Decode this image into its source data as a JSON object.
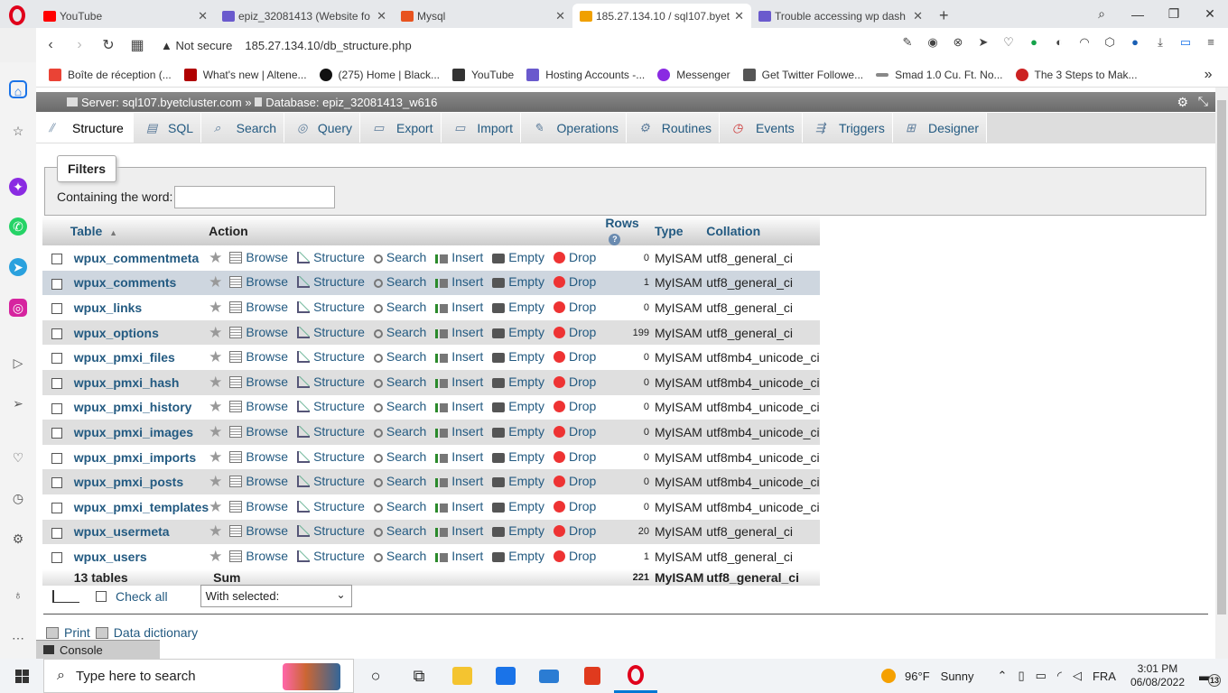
{
  "browser": {
    "tabs": [
      {
        "title": "YouTube",
        "color": "#ff0000"
      },
      {
        "title": "epiz_32081413 (Website fo",
        "color": "#6a5acd"
      },
      {
        "title": "Mysql",
        "color": "#e8531f"
      },
      {
        "title": "185.27.134.10 / sql107.byet",
        "color": "#f0a000"
      },
      {
        "title": "Trouble accessing wp dash",
        "color": "#6a5acd"
      }
    ],
    "new_tab": "+",
    "security": "Not secure",
    "url": "185.27.134.10/db_structure.php",
    "bookmarks": [
      {
        "label": "Boîte de réception (...",
        "color": "#ea4335"
      },
      {
        "label": "What's new | Altene...",
        "color": "#b00000"
      },
      {
        "label": "(275) Home | Black...",
        "color": "#111111"
      },
      {
        "label": "YouTube",
        "color": "#333333"
      },
      {
        "label": "Hosting Accounts -...",
        "color": "#6a5acd"
      },
      {
        "label": "Messenger",
        "color": "#8a2be2"
      },
      {
        "label": "Get Twitter Followe...",
        "color": "#555555"
      },
      {
        "label": "Smad 1.0 Cu. Ft. No...",
        "color": "#888888"
      },
      {
        "label": "The 3 Steps to Mak...",
        "color": "#cc2222"
      }
    ],
    "bookmarks_more": "»"
  },
  "pma": {
    "breadcrumb": {
      "server": "Server: sql107.byetcluster.com »",
      "database": "Database: epiz_32081413_w616"
    },
    "tabs": [
      "Structure",
      "SQL",
      "Search",
      "Query",
      "Export",
      "Import",
      "Operations",
      "Routines",
      "Events",
      "Triggers",
      "Designer"
    ],
    "filters": {
      "legend": "Filters",
      "label": "Containing the word:",
      "value": ""
    },
    "columns": {
      "table": "Table",
      "sort": "▲",
      "action": "Action",
      "rows": "Rows",
      "rows_help": "?",
      "type": "Type",
      "collation": "Collation"
    },
    "actions": {
      "browse": "Browse",
      "structure": "Structure",
      "search": "Search",
      "insert": "Insert",
      "empty": "Empty",
      "drop": "Drop"
    },
    "tables": [
      {
        "name": "wpux_commentmeta",
        "rows": "0",
        "type": "MyISAM",
        "collation": "utf8_general_ci"
      },
      {
        "name": "wpux_comments",
        "rows": "1",
        "type": "MyISAM",
        "collation": "utf8_general_ci"
      },
      {
        "name": "wpux_links",
        "rows": "0",
        "type": "MyISAM",
        "collation": "utf8_general_ci"
      },
      {
        "name": "wpux_options",
        "rows": "199",
        "type": "MyISAM",
        "collation": "utf8_general_ci"
      },
      {
        "name": "wpux_pmxi_files",
        "rows": "0",
        "type": "MyISAM",
        "collation": "utf8mb4_unicode_ci"
      },
      {
        "name": "wpux_pmxi_hash",
        "rows": "0",
        "type": "MyISAM",
        "collation": "utf8mb4_unicode_ci"
      },
      {
        "name": "wpux_pmxi_history",
        "rows": "0",
        "type": "MyISAM",
        "collation": "utf8mb4_unicode_ci"
      },
      {
        "name": "wpux_pmxi_images",
        "rows": "0",
        "type": "MyISAM",
        "collation": "utf8mb4_unicode_ci"
      },
      {
        "name": "wpux_pmxi_imports",
        "rows": "0",
        "type": "MyISAM",
        "collation": "utf8mb4_unicode_ci"
      },
      {
        "name": "wpux_pmxi_posts",
        "rows": "0",
        "type": "MyISAM",
        "collation": "utf8mb4_unicode_ci"
      },
      {
        "name": "wpux_pmxi_templates",
        "rows": "0",
        "type": "MyISAM",
        "collation": "utf8mb4_unicode_ci"
      },
      {
        "name": "wpux_usermeta",
        "rows": "20",
        "type": "MyISAM",
        "collation": "utf8_general_ci"
      },
      {
        "name": "wpux_users",
        "rows": "1",
        "type": "MyISAM",
        "collation": "utf8_general_ci"
      }
    ],
    "footer": {
      "count": "13 tables",
      "sum": "Sum",
      "rows": "221",
      "type": "MyISAM",
      "collation": "utf8_general_ci"
    },
    "bulk": {
      "check_all": "Check all",
      "with_selected": "With selected:"
    },
    "print": "Print",
    "data_dictionary": "Data dictionary",
    "console": "Console"
  },
  "taskbar": {
    "search_placeholder": "Type here to search",
    "weather_temp": "96°F",
    "weather_text": "Sunny",
    "lang": "FRA",
    "time": "3:01 PM",
    "date": "06/08/2022",
    "notifications": "13"
  }
}
